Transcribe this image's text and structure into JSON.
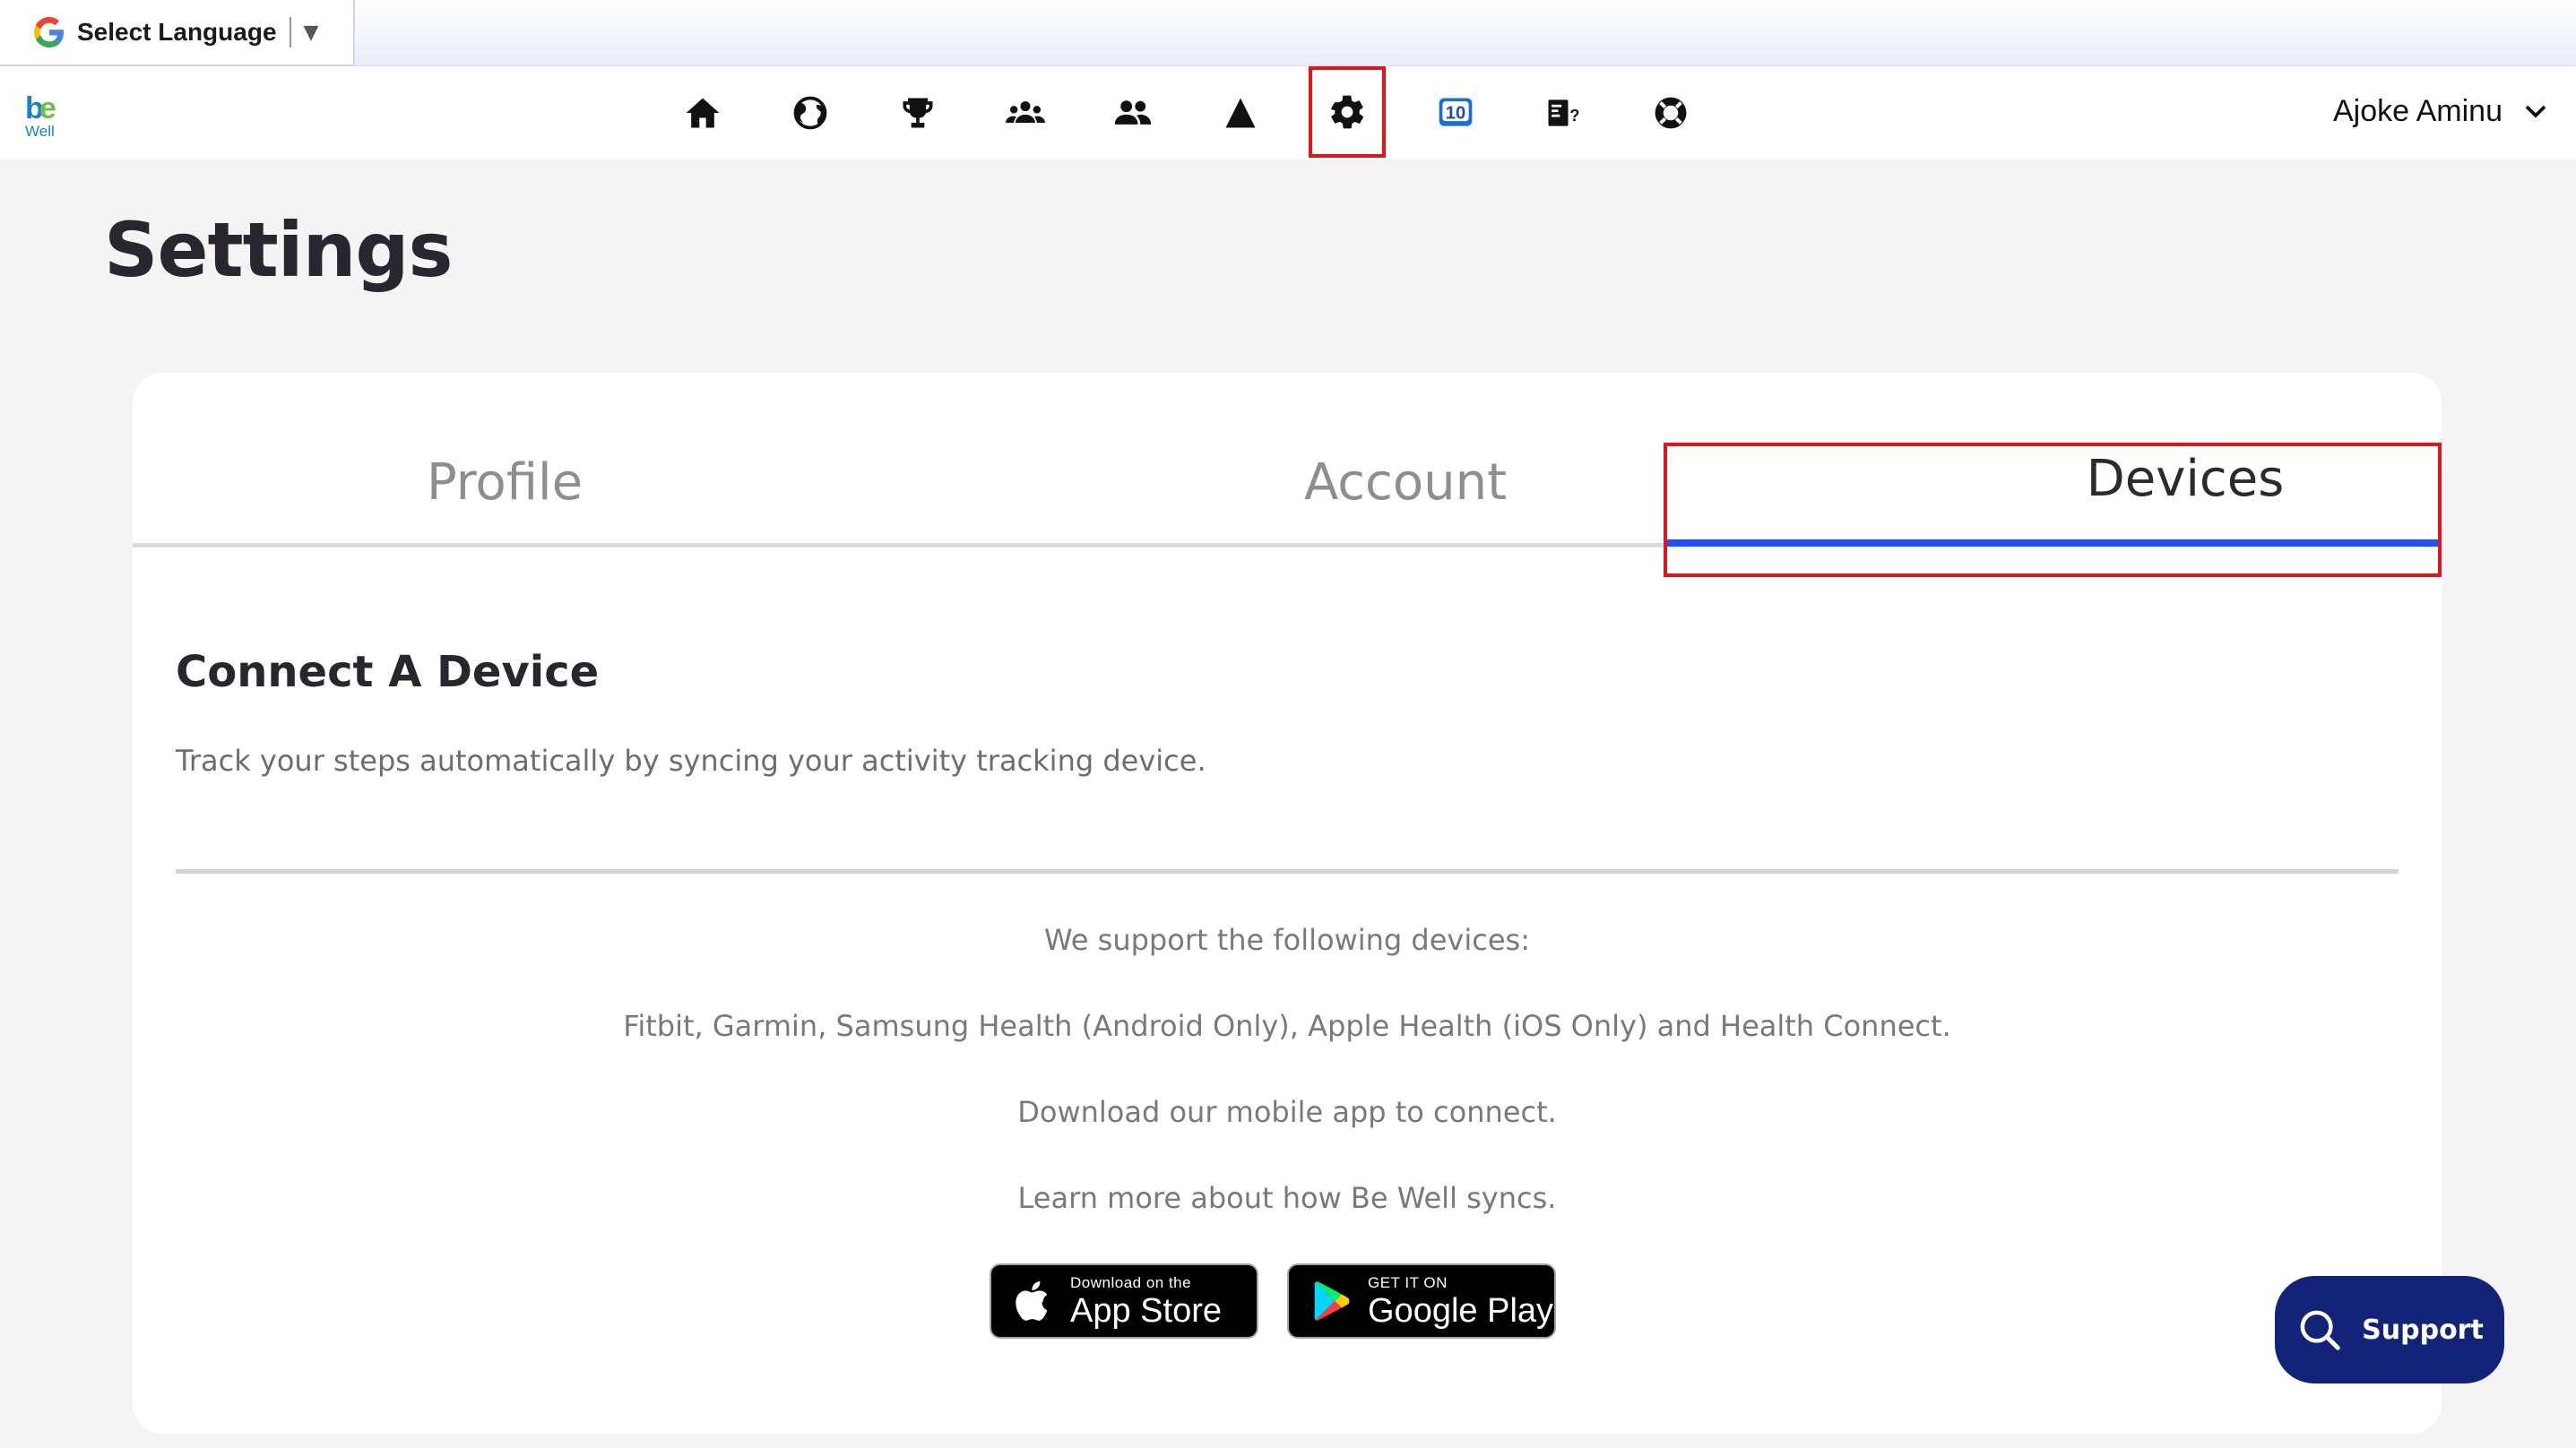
{
  "translate_bar": {
    "label": "Select Language",
    "arrow": "▼"
  },
  "nav": {
    "logo_text": "Well",
    "icons": [
      "home-icon",
      "globe-icon",
      "trophy-icon",
      "group-icon",
      "friends-icon",
      "mountain-icon",
      "gear-icon",
      "calendar-10-icon",
      "quiz-icon",
      "lifebuoy-icon"
    ],
    "user_name": "Ajoke Aminu"
  },
  "page": {
    "title": "Settings"
  },
  "tabs": [
    {
      "label": "Profile",
      "active": false
    },
    {
      "label": "Account",
      "active": false
    },
    {
      "label": "Devices",
      "active": true
    }
  ],
  "devices": {
    "section_title": "Connect A Device",
    "description": "Track your steps automatically by syncing your activity tracking device.",
    "support_line": "We support the following devices:",
    "device_list": "Fitbit, Garmin, Samsung Health (Android Only), Apple Health (iOS Only) and Health Connect.",
    "download_line": "Download our mobile app to connect.",
    "learn_more": "Learn more about how Be Well syncs.",
    "app_store": {
      "small": "Download on the",
      "big": "App Store"
    },
    "google_play": {
      "small": "GET IT ON",
      "big": "Google Play"
    }
  },
  "support_button": {
    "label": "Support"
  },
  "colors": {
    "accent_blue": "#1f52f2",
    "highlight_red": "#e0141c",
    "support_navy": "#13237a"
  }
}
